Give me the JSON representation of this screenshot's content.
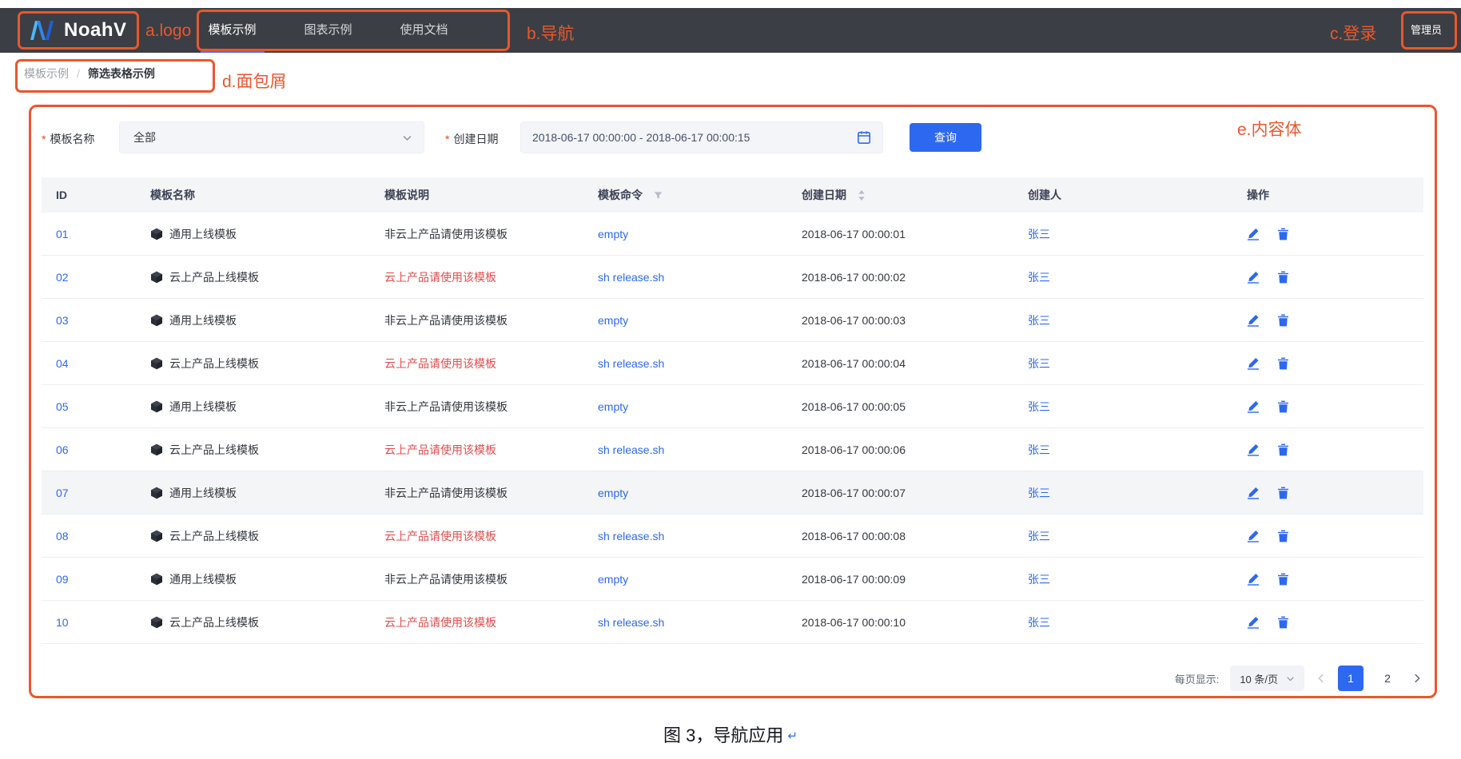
{
  "header": {
    "brand": "NoahV",
    "nav": [
      {
        "label": "模板示例",
        "active": true
      },
      {
        "label": "图表示例",
        "active": false
      },
      {
        "label": "使用文档",
        "active": false
      }
    ],
    "user": "管理员"
  },
  "breadcrumb": {
    "items": [
      "模板示例",
      "筛选表格示例"
    ],
    "separator": "/"
  },
  "filters": {
    "required_marker": "*",
    "name_label": "模板名称",
    "name_value": "全部",
    "date_label": "创建日期",
    "date_value": "2018-06-17 00:00:00 - 2018-06-17 00:00:15",
    "search_button": "查询"
  },
  "table": {
    "columns": [
      "ID",
      "模板名称",
      "模板说明",
      "模板命令",
      "创建日期",
      "创建人",
      "操作"
    ],
    "rows": [
      {
        "id": "01",
        "name": "通用上线模板",
        "desc": "非云上产品请使用该模板",
        "desc_danger": false,
        "cmd": "empty",
        "date": "2018-06-17 00:00:01",
        "creator": "张三",
        "highlighted": false
      },
      {
        "id": "02",
        "name": "云上产品上线模板",
        "desc": "云上产品请使用该模板",
        "desc_danger": true,
        "cmd": "sh release.sh",
        "date": "2018-06-17 00:00:02",
        "creator": "张三",
        "highlighted": false
      },
      {
        "id": "03",
        "name": "通用上线模板",
        "desc": "非云上产品请使用该模板",
        "desc_danger": false,
        "cmd": "empty",
        "date": "2018-06-17 00:00:03",
        "creator": "张三",
        "highlighted": false
      },
      {
        "id": "04",
        "name": "云上产品上线模板",
        "desc": "云上产品请使用该模板",
        "desc_danger": true,
        "cmd": "sh release.sh",
        "date": "2018-06-17 00:00:04",
        "creator": "张三",
        "highlighted": false
      },
      {
        "id": "05",
        "name": "通用上线模板",
        "desc": "非云上产品请使用该模板",
        "desc_danger": false,
        "cmd": "empty",
        "date": "2018-06-17 00:00:05",
        "creator": "张三",
        "highlighted": false
      },
      {
        "id": "06",
        "name": "云上产品上线模板",
        "desc": "云上产品请使用该模板",
        "desc_danger": true,
        "cmd": "sh release.sh",
        "date": "2018-06-17 00:00:06",
        "creator": "张三",
        "highlighted": false
      },
      {
        "id": "07",
        "name": "通用上线模板",
        "desc": "非云上产品请使用该模板",
        "desc_danger": false,
        "cmd": "empty",
        "date": "2018-06-17 00:00:07",
        "creator": "张三",
        "highlighted": true
      },
      {
        "id": "08",
        "name": "云上产品上线模板",
        "desc": "云上产品请使用该模板",
        "desc_danger": true,
        "cmd": "sh release.sh",
        "date": "2018-06-17 00:00:08",
        "creator": "张三",
        "highlighted": false
      },
      {
        "id": "09",
        "name": "通用上线模板",
        "desc": "非云上产品请使用该模板",
        "desc_danger": false,
        "cmd": "empty",
        "date": "2018-06-17 00:00:09",
        "creator": "张三",
        "highlighted": false
      },
      {
        "id": "10",
        "name": "云上产品上线模板",
        "desc": "云上产品请使用该模板",
        "desc_danger": true,
        "cmd": "sh release.sh",
        "date": "2018-06-17 00:00:10",
        "creator": "张三",
        "highlighted": false
      }
    ]
  },
  "pagination": {
    "page_size_label": "每页显示:",
    "page_size_value": "10 条/页",
    "pages": [
      "1",
      "2"
    ],
    "current": "1"
  },
  "caption": {
    "text": "图 3，导航应用",
    "mark": "↵"
  },
  "annotations": {
    "labels": {
      "a": "a.logo",
      "b": "b.导航",
      "c": "c.登录",
      "d": "d.面包屑",
      "e": "e.内容体"
    }
  },
  "colors": {
    "accent": "#2d68f0",
    "danger": "#e34d4d",
    "annotation": "#e8582d",
    "header_bg": "#3b3e44"
  }
}
